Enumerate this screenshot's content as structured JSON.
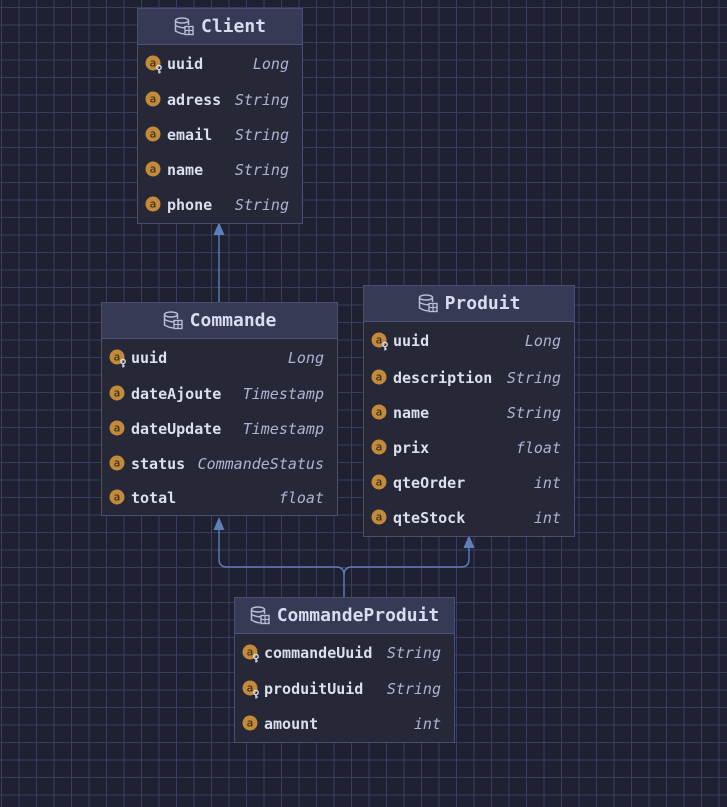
{
  "diagram": {
    "entities": [
      {
        "id": "client",
        "title": "Client",
        "fields": [
          {
            "name": "uuid",
            "type": "Long",
            "key": true
          },
          {
            "name": "adress",
            "type": "String",
            "key": false
          },
          {
            "name": "email",
            "type": "String",
            "key": false
          },
          {
            "name": "name",
            "type": "String",
            "key": false
          },
          {
            "name": "phone",
            "type": "String",
            "key": false
          }
        ]
      },
      {
        "id": "commande",
        "title": "Commande",
        "fields": [
          {
            "name": "uuid",
            "type": "Long",
            "key": true
          },
          {
            "name": "dateAjoute",
            "type": "Timestamp",
            "key": false
          },
          {
            "name": "dateUpdate",
            "type": "Timestamp",
            "key": false
          },
          {
            "name": "status",
            "type": "CommandeStatus",
            "key": false
          },
          {
            "name": "total",
            "type": "float",
            "key": false
          }
        ]
      },
      {
        "id": "produit",
        "title": "Produit",
        "fields": [
          {
            "name": "uuid",
            "type": "Long",
            "key": true
          },
          {
            "name": "description",
            "type": "String",
            "key": false
          },
          {
            "name": "name",
            "type": "String",
            "key": false
          },
          {
            "name": "prix",
            "type": "float",
            "key": false
          },
          {
            "name": "qteOrder",
            "type": "int",
            "key": false
          },
          {
            "name": "qteStock",
            "type": "int",
            "key": false
          }
        ]
      },
      {
        "id": "commandeproduit",
        "title": "CommandeProduit",
        "fields": [
          {
            "name": "commandeUuid",
            "type": "String",
            "key": true
          },
          {
            "name": "produitUuid",
            "type": "String",
            "key": true
          },
          {
            "name": "amount",
            "type": "int",
            "key": false
          }
        ]
      }
    ],
    "relations": [
      {
        "from": "Commande",
        "to": "Client"
      },
      {
        "from": "CommandeProduit",
        "to": "Commande"
      },
      {
        "from": "CommandeProduit",
        "to": "Produit"
      }
    ]
  },
  "colors": {
    "background": "#1f2133",
    "grid": "#3a3d62",
    "header": "#373a55",
    "body": "#262838",
    "connector": "#5e7fb8",
    "field_icon": "#c28a3a"
  },
  "icons": {
    "table": "database-table-icon",
    "field": "field-icon",
    "key": "key-field-icon"
  }
}
